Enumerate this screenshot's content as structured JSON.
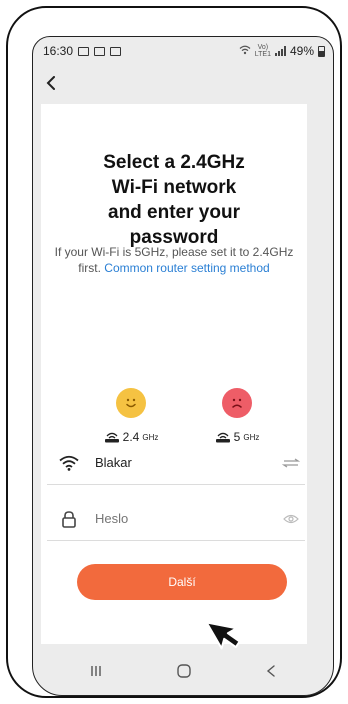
{
  "status_bar": {
    "time": "16:30",
    "network_label": "Vo)",
    "network_sub": "LTE1",
    "battery": "49%"
  },
  "header": {
    "back_icon": "chevron-left-icon"
  },
  "main": {
    "title_line1": "Select a 2.4GHz",
    "title_line2": "Wi-Fi network",
    "title_line3": "and enter your",
    "title_line4": "password",
    "subtitle_text": "If your Wi-Fi is 5GHz, please set it to 2.4GHz first. ",
    "subtitle_link": "Common router setting method",
    "band_24_value": "2.4",
    "band_24_unit": "GHz",
    "band_5_value": "5",
    "band_5_unit": "GHz",
    "happy_color": "#f5c242",
    "sad_color": "#ee5d67"
  },
  "form": {
    "wifi_name": "Blakar",
    "password_placeholder": "Heslo",
    "next_label": "Další",
    "accent": "#f26a3d"
  },
  "nav": {
    "recent_icon": "recent-apps-icon",
    "home_icon": "home-icon",
    "back_icon": "back-icon"
  }
}
